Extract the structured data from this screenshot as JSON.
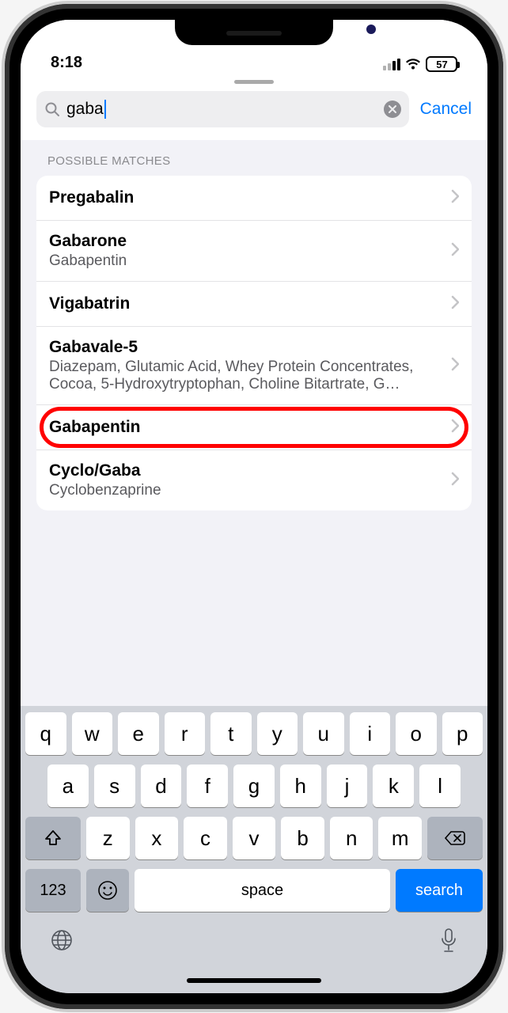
{
  "status": {
    "time": "8:18",
    "battery": "57"
  },
  "search": {
    "value": "gaba",
    "cancel": "Cancel"
  },
  "section_header": "POSSIBLE MATCHES",
  "items": [
    {
      "title": "Pregabalin",
      "sub": ""
    },
    {
      "title": "Gabarone",
      "sub": "Gabapentin"
    },
    {
      "title": "Vigabatrin",
      "sub": ""
    },
    {
      "title": "Gabavale-5",
      "sub": "Diazepam, Glutamic Acid, Whey Protein Concentrates, Cocoa, 5-Hydroxytryptophan, Choline Bitartrate, G…"
    },
    {
      "title": "Gabapentin",
      "sub": ""
    },
    {
      "title": "Cyclo/Gaba",
      "sub": "Cyclobenzaprine"
    }
  ],
  "highlighted_index": 4,
  "keyboard": {
    "row1": [
      "q",
      "w",
      "e",
      "r",
      "t",
      "y",
      "u",
      "i",
      "o",
      "p"
    ],
    "row2": [
      "a",
      "s",
      "d",
      "f",
      "g",
      "h",
      "j",
      "k",
      "l"
    ],
    "row3": [
      "z",
      "x",
      "c",
      "v",
      "b",
      "n",
      "m"
    ],
    "numbers": "123",
    "space": "space",
    "search": "search"
  }
}
